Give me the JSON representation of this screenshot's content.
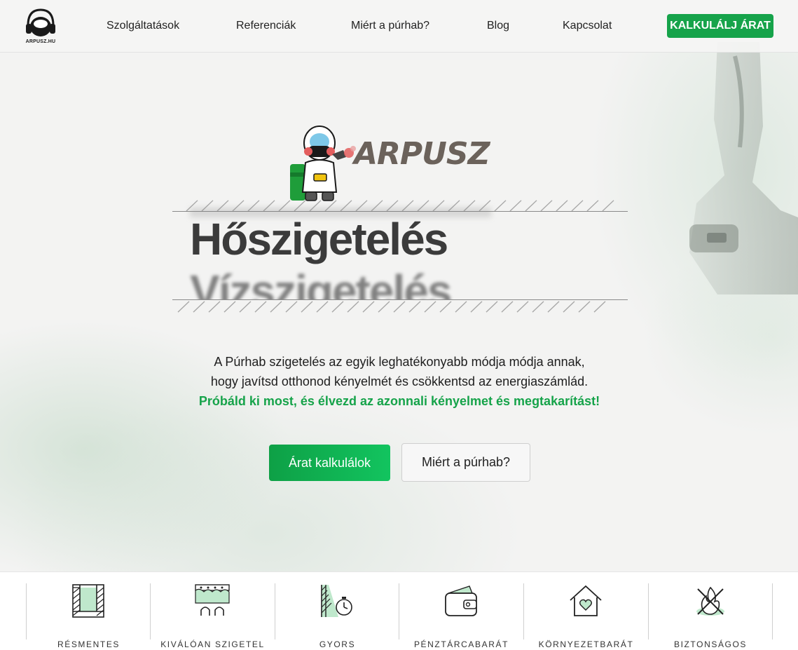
{
  "brand": {
    "logo_text": "ARPUSZ.HU",
    "hero_logo_text": "ARPUSZ",
    "accent_color": "#16a34a"
  },
  "nav": {
    "items": [
      {
        "label": "Szolgáltatások"
      },
      {
        "label": "Referenciák"
      },
      {
        "label": "Miért a púrhab?"
      },
      {
        "label": "Blog"
      },
      {
        "label": "Kapcsolat"
      }
    ],
    "cta_label": "KALKULÁLJ ÁRAT"
  },
  "hero": {
    "headline_primary": "Hőszigetelés",
    "headline_secondary": "Vízszigetelés",
    "description_line1": "A Púrhab szigetelés az egyik leghatékonyabb módja módja annak,",
    "description_line2": "hogy javítsd otthonod kényelmét és csökkentsd az energiaszámlád.",
    "description_highlight": "Próbáld ki most, és élvezd az azonnali kényelmet és megtakarítást!",
    "primary_button": "Árat kalkulálok",
    "secondary_button": "Miért a púrhab?"
  },
  "features": [
    {
      "label": "RÉSMENTES",
      "icon": "wall-gap-icon"
    },
    {
      "label": "KIVÁLÓAN SZIGETEL",
      "icon": "foam-layer-icon"
    },
    {
      "label": "GYORS",
      "icon": "stopwatch-icon"
    },
    {
      "label": "PÉNZTÁRCABARÁT",
      "icon": "wallet-icon"
    },
    {
      "label": "KÖRNYEZETBARÁT",
      "icon": "eco-house-icon"
    },
    {
      "label": "BIZTONSÁGOS",
      "icon": "no-fire-icon"
    }
  ]
}
